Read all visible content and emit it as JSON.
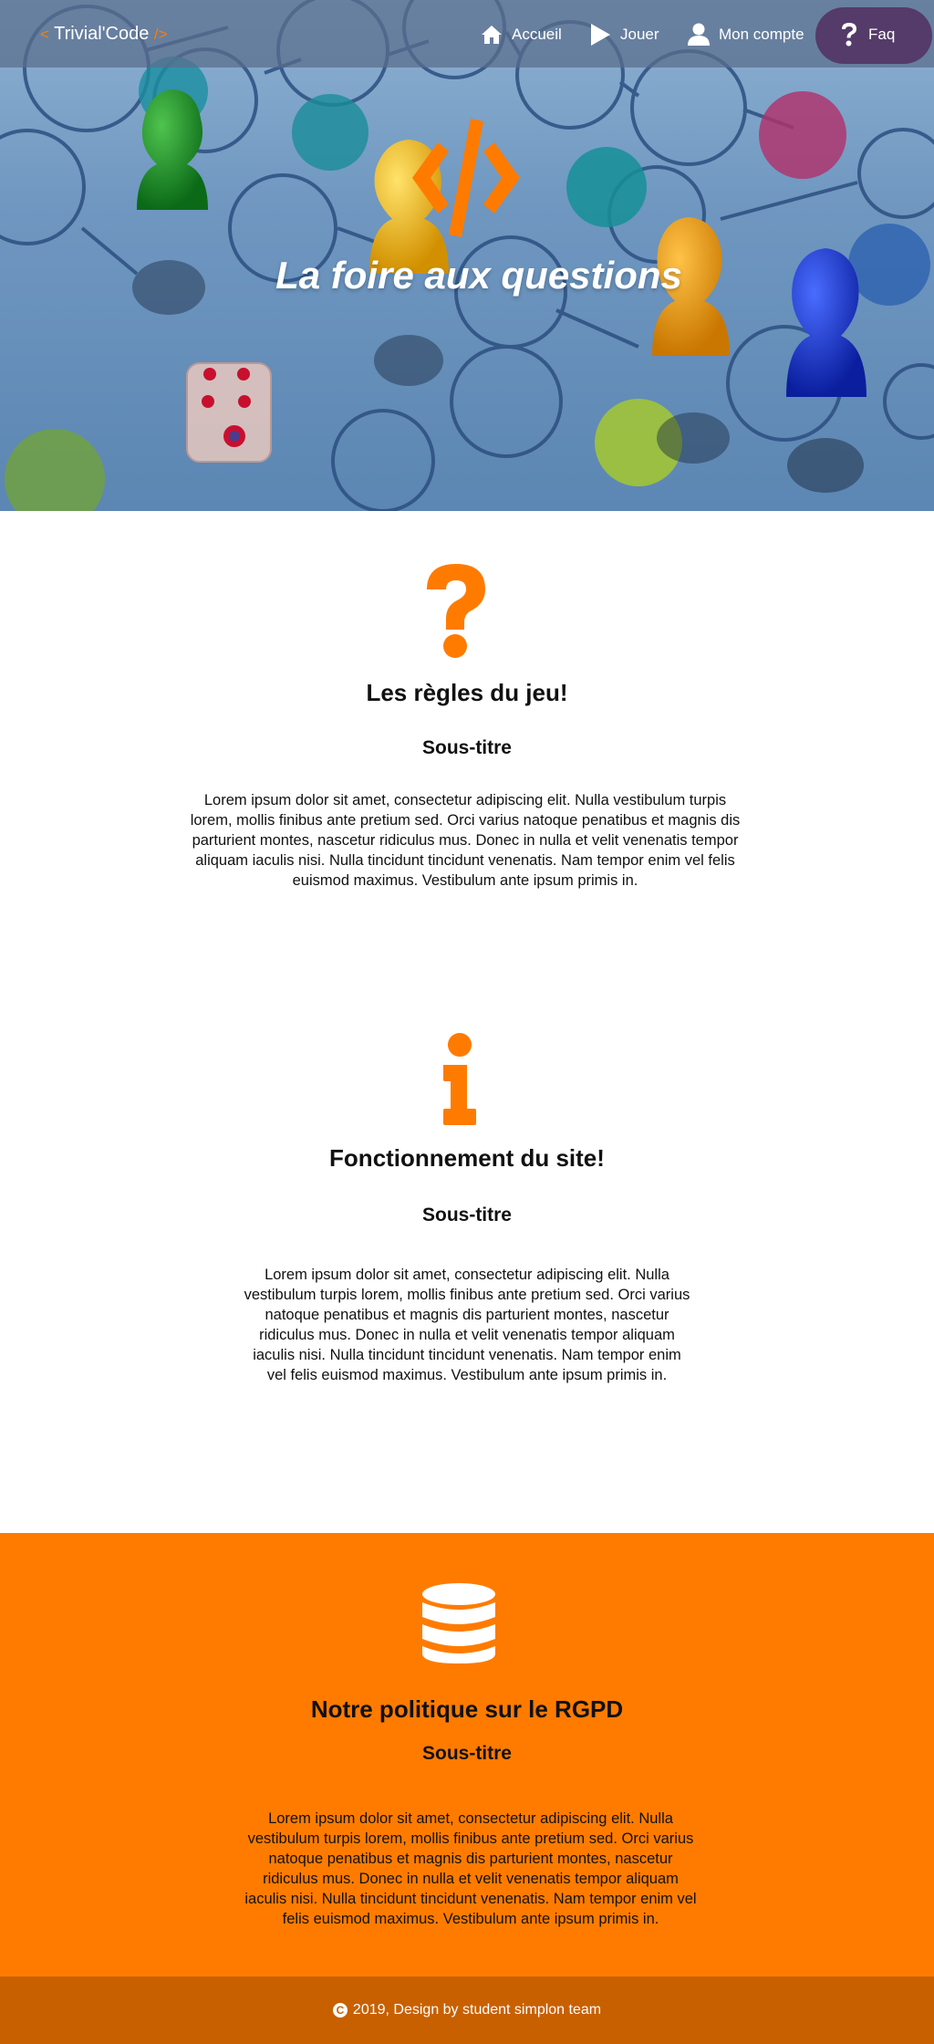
{
  "brand": {
    "open": "<",
    "name": "Trivial'Code",
    "close": "/>"
  },
  "nav": [
    {
      "label": "Accueil",
      "icon": "home-icon"
    },
    {
      "label": "Jouer",
      "icon": "play-icon"
    },
    {
      "label": "Mon compte",
      "icon": "user-icon"
    },
    {
      "label": "Faq",
      "icon": "question-icon",
      "active": true
    }
  ],
  "hero": {
    "title": "La foire aux questions",
    "icon": "code-icon"
  },
  "sections": [
    {
      "icon": "question-mark-icon",
      "title": "Les règles du jeu!",
      "subtitle": "Sous-titre",
      "lines": [
        "Lorem ipsum dolor sit amet, consectetur adipiscing elit. Nulla vestibulum turpis",
        "lorem, mollis finibus ante pretium sed. Orci varius natoque penatibus et magnis dis",
        "parturient montes, nascetur ridiculus mus. Donec in nulla et velit venenatis tempor",
        "aliquam iaculis nisi. Nulla tincidunt tincidunt venenatis. Nam tempor enim vel felis",
        "euismod maximus. Vestibulum ante ipsum primis in."
      ]
    },
    {
      "icon": "info-icon",
      "title": "Fonctionnement du site!",
      "subtitle": "Sous-titre",
      "lines": [
        "Lorem ipsum dolor sit amet, consectetur adipiscing elit. Nulla",
        "vestibulum turpis lorem, mollis finibus ante pretium sed. Orci varius",
        "natoque penatibus et magnis dis parturient montes, nascetur",
        "ridiculus mus. Donec in nulla et velit venenatis tempor aliquam",
        "iaculis nisi. Nulla tincidunt tincidunt venenatis. Nam tempor enim",
        "vel felis euismod maximus. Vestibulum ante ipsum primis in."
      ]
    },
    {
      "icon": "database-icon",
      "title": "Notre politique sur le RGPD",
      "subtitle": "Sous-titre",
      "lines": [
        "Lorem ipsum dolor sit amet, consectetur adipiscing elit. Nulla",
        "vestibulum turpis lorem, mollis finibus ante pretium sed. Orci varius",
        "natoque penatibus et magnis dis parturient montes, nascetur",
        "ridiculus mus. Donec in nulla et velit venenatis tempor aliquam",
        "iaculis nisi. Nulla tincidunt tincidunt venenatis. Nam tempor enim vel",
        "felis euismod maximus. Vestibulum ante ipsum primis in."
      ]
    }
  ],
  "footer": {
    "text": "2019, Design by student simplon team",
    "icon": "copyright-icon"
  },
  "colors": {
    "accent": "#ff7b00",
    "footer": "#c86000",
    "nav_active": "#50285a"
  }
}
